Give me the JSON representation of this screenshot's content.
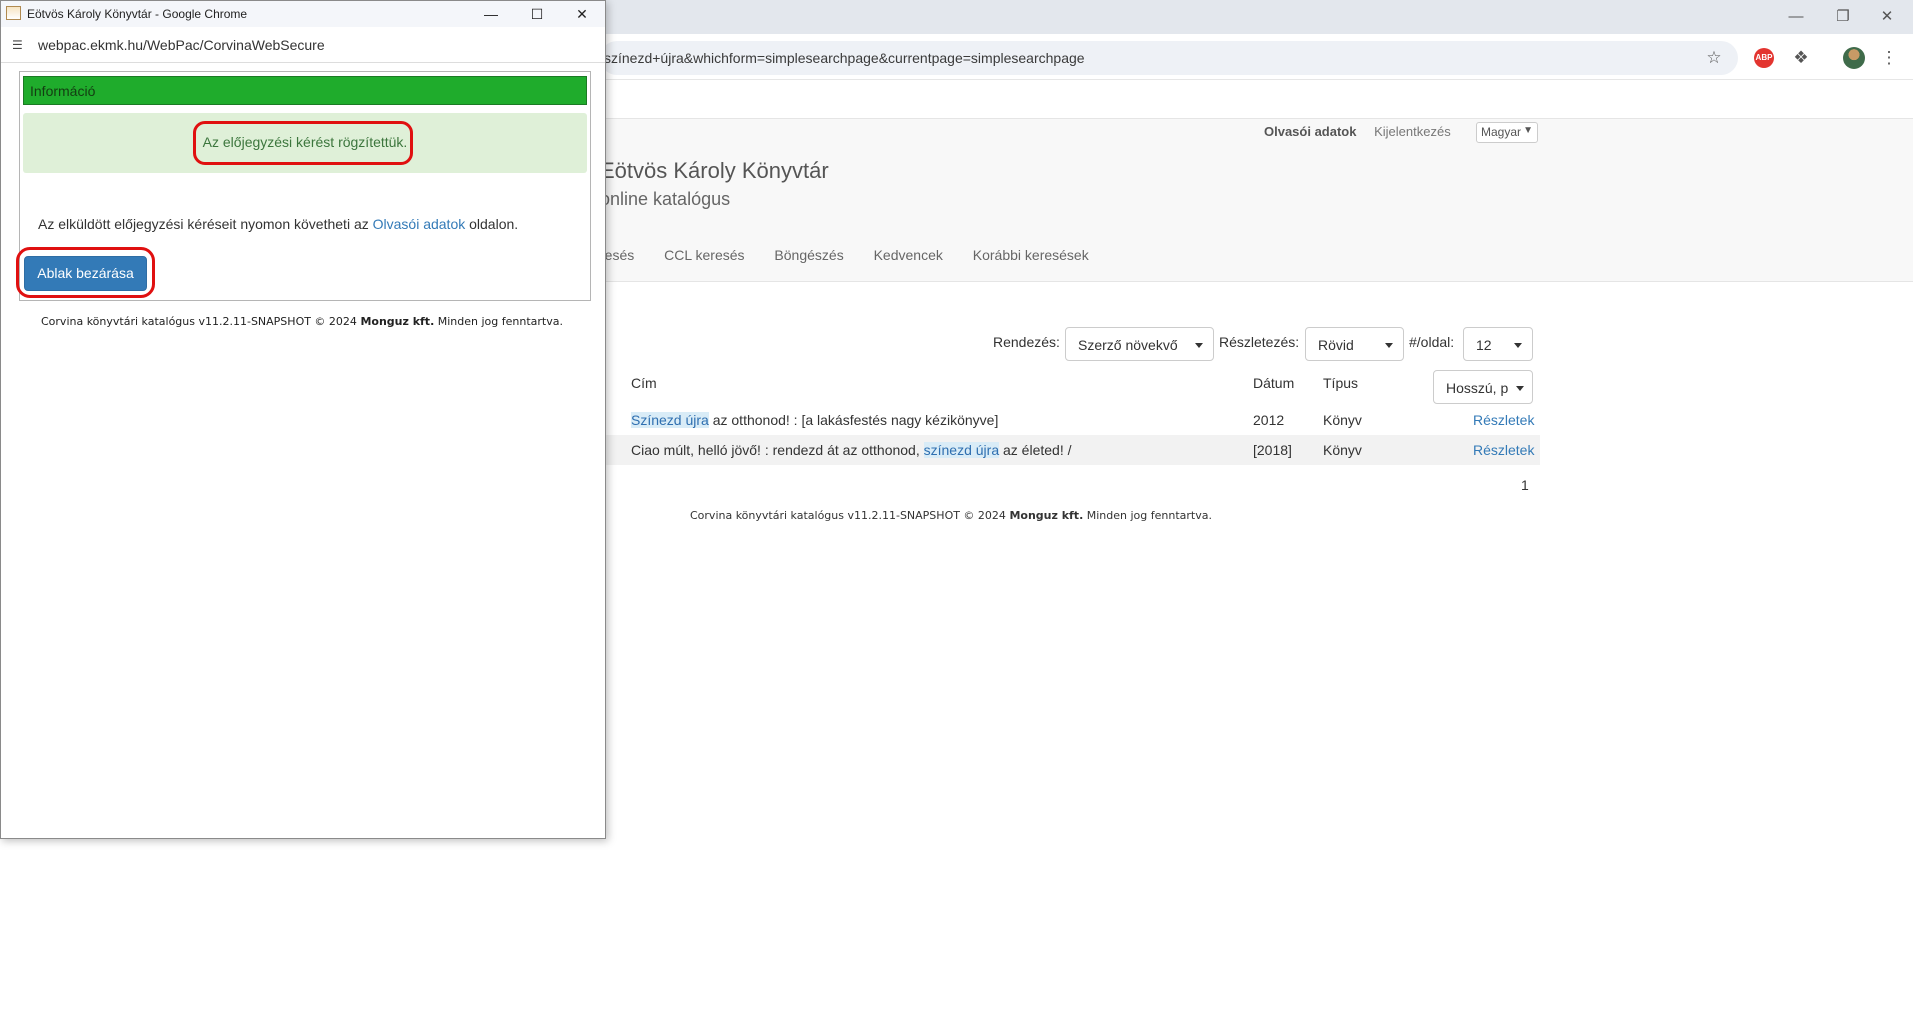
{
  "main_window": {
    "url_fragment": "színezd+újra&whichform=simplesearchpage&currentpage=simplesearchpage"
  },
  "header": {
    "reader_data": "Olvasói adatok",
    "logout": "Kijelentkezés",
    "language": "Magyar",
    "site_title": "Eötvös Károly Könyvtár",
    "site_subtitle": "online katalógus",
    "nav": [
      "resés",
      "CCL keresés",
      "Böngészés",
      "Kedvencek",
      "Korábbi keresések"
    ]
  },
  "controls": {
    "sort_label": "Rendezés:",
    "sort_value": "Szerző növekvő",
    "detail_label": "Részletezés:",
    "detail_value": "Rövid",
    "per_page_label": "#/oldal:",
    "per_page_value": "12",
    "format_value": "Hosszú, p"
  },
  "table": {
    "headers": {
      "title": "Cím",
      "date": "Dátum",
      "type": "Típus"
    },
    "rows": [
      {
        "title_pre": "",
        "title_hl": "Színezd újra",
        "title_post": " az otthonod! : [a lakásfestés nagy kézikönyve]",
        "date": "2012",
        "type": "Könyv",
        "details": "Részletek"
      },
      {
        "title_pre": "Ciao múlt, helló jövő! : rendezd át az otthonod, ",
        "title_hl": "színezd újra",
        "title_post": " az életed! /",
        "date": "[2018]",
        "type": "Könyv",
        "details": "Részletek"
      }
    ],
    "page": "1"
  },
  "footer": {
    "text_pre": "Corvina könyvtári katalógus v11.2.11-SNAPSHOT © 2024 ",
    "company": "Monguz kft.",
    "text_post": " Minden jog fenntartva."
  },
  "popup": {
    "window_title": "Eötvös Károly Könyvtár - Google Chrome",
    "url": "webpac.ekmk.hu/WebPac/CorvinaWebSecure",
    "info_title": "Információ",
    "info_message": "Az előjegyzési kérést rögzítettük.",
    "text_pre": "Az elküldött előjegyzési kéréseit nyomon követheti az ",
    "text_link": "Olvasói adatok",
    "text_post": " oldalon.",
    "close_button": "Ablak bezárása"
  },
  "colors": {
    "info_header": "#1fac2c",
    "info_box": "#dff0d8",
    "button": "#337ab7",
    "annotation": "#e01010"
  }
}
